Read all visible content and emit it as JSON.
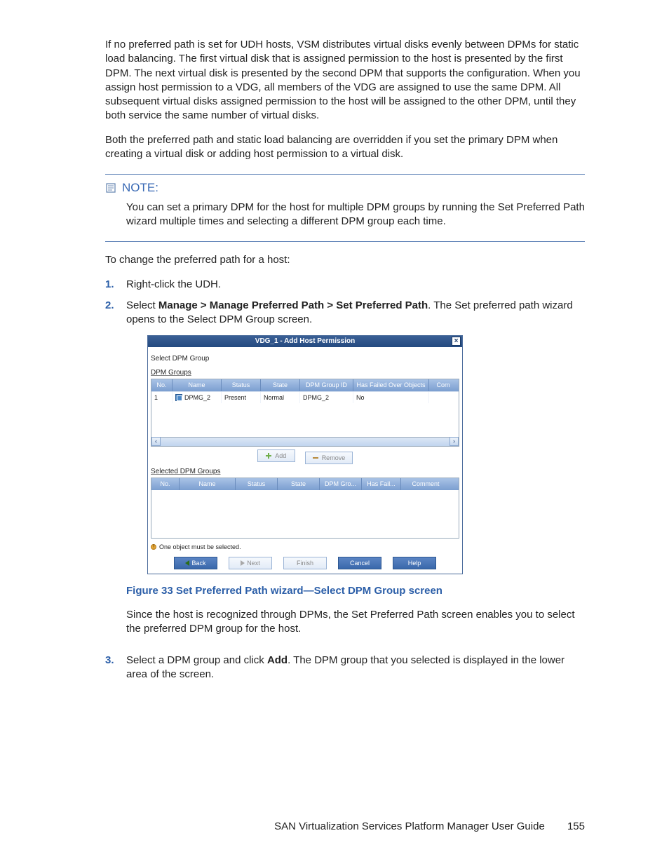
{
  "para1": "If no preferred path is set for UDH hosts, VSM distributes virtual disks evenly between DPMs for static load balancing. The first virtual disk that is assigned permission to the host is presented by the first DPM. The next virtual disk is presented by the second DPM that supports the configuration. When you assign host permission to a VDG, all members of the VDG are assigned to use the same DPM. All subsequent virtual disks assigned permission to the host will be assigned to the other DPM, until they both service the same number of virtual disks.",
  "para2": "Both the preferred path and static load balancing are overridden if you set the primary DPM when creating a virtual disk or adding host permission to a virtual disk.",
  "note_label": "NOTE:",
  "note_body": "You can set a primary DPM for the host for multiple DPM groups by running the Set Preferred Path wizard multiple times and selecting a different DPM group each time.",
  "lead": "To change the preferred path for a host:",
  "steps": {
    "s1": "Right-click the UDH.",
    "s2_a": "Select ",
    "s2_b": "Manage > Manage Preferred Path > Set Preferred Path",
    "s2_c": ". The Set preferred path wizard opens to the Select DPM Group screen.",
    "s3_a": "Select a DPM group and click ",
    "s3_b": "Add",
    "s3_c": ". The DPM group that you selected is displayed in the lower area of the screen."
  },
  "dialog": {
    "title": "VDG_1 - Add Host Permission",
    "sec1": "Select DPM Group",
    "groups_label": "DPM Groups",
    "head1": {
      "no": "No.",
      "name": "Name",
      "status": "Status",
      "state": "State",
      "gid": "DPM Group ID",
      "fail": "Has Failed Over Objects",
      "com": "Com"
    },
    "row1": {
      "no": "1",
      "name": "DPMG_2",
      "status": "Present",
      "state": "Normal",
      "gid": "DPMG_2",
      "fail": "No",
      "com": ""
    },
    "add_btn": "Add",
    "remove_btn": "Remove",
    "selected_label": "Selected DPM Groups",
    "head2": {
      "no": "No.",
      "name": "Name",
      "status": "Status",
      "state": "State",
      "gid": "DPM Gro...",
      "fail": "Has Fail...",
      "com": "Comment"
    },
    "warn": "One object must be selected.",
    "back": "Back",
    "next": "Next",
    "finish": "Finish",
    "cancel": "Cancel",
    "help": "Help"
  },
  "fig_caption": "Figure 33 Set Preferred Path wizard—Select DPM Group screen",
  "after_fig": "Since the host is recognized through DPMs, the Set Preferred Path screen enables you to select the preferred DPM group for the host.",
  "footer_title": "SAN Virtualization Services Platform Manager User Guide",
  "page_no": "155"
}
